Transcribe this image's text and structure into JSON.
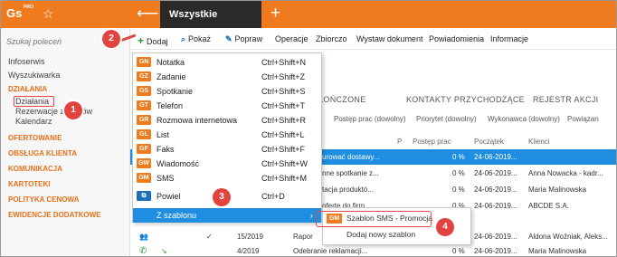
{
  "app": {
    "logo": "Gs",
    "logo_sup": "PRO",
    "window_tab": "Wszystkie działania",
    "back_icon": "arrow-left-icon",
    "new_tab_icon": "plus-icon",
    "accent": "#f07b1e",
    "selection": "#1f8de0",
    "annotation": "#e3433f"
  },
  "sidebar": {
    "search_placeholder": "Szukaj poleceń",
    "items": [
      {
        "label": "Infoserwis"
      },
      {
        "label": "Wyszukiwarka"
      },
      {
        "label": "DZIAŁANIA"
      },
      {
        "label": "Działania"
      },
      {
        "label": "Rezerwacje zasobów"
      },
      {
        "label": "Kalendarz"
      },
      {
        "label": "OFERTOWANIE"
      },
      {
        "label": "OBSŁUGA KLIENTA"
      },
      {
        "label": "KOMUNIKACJA"
      },
      {
        "label": "KARTOTEKI"
      },
      {
        "label": "POLITYKA CENOWA"
      },
      {
        "label": "EWIDENCJE DODATKOWE"
      }
    ]
  },
  "toolbar": {
    "dodaj": "Dodaj",
    "pokaz": "Pokaż",
    "popraw": "Popraw",
    "operacje": "Operacje",
    "zbiorczo": "Zbiorczo",
    "wystaw": "Wystaw dokument",
    "powiadomienia": "Powiadomienia",
    "informacje": "Informacje"
  },
  "tabs": [
    "ZAKOŃCZONE",
    "KONTAKTY PRZYCHODZĄCE",
    "REJESTR AKCJI"
  ],
  "filters": [
    "Postęp prac (dowolny)",
    "Priorytet (dowolny)",
    "Wykonawca (dowolny)",
    "Powiązan"
  ],
  "columns": {
    "p": "P",
    "postep": "Postęp prac",
    "poczatek": "Początek",
    "klienci": "Klienci"
  },
  "rows": [
    {
      "nr": "",
      "temat": "urować dostawy...",
      "postep": "0 %",
      "data": "24-06-2019...",
      "klient": ""
    },
    {
      "nr": "",
      "temat": "nne spotkanie z...",
      "postep": "0 %",
      "data": "24-06-2019...",
      "klient": "Anna Nowacka - kadr..."
    },
    {
      "nr": "",
      "temat": "tacja produktó...",
      "postep": "0 %",
      "data": "24-06-2019...",
      "klient": "Maria Malinowska"
    },
    {
      "nr": "",
      "temat": "oferte do firm...",
      "postep": "0 %",
      "data": "24-06-2019...",
      "klient": "ABCDE S.A."
    },
    {
      "nr": "",
      "temat": "",
      "postep": "",
      "data": "",
      "klient": ""
    },
    {
      "nr": "",
      "temat": "",
      "postep": "",
      "data": "",
      "klient": ""
    },
    {
      "nr": "15/2019",
      "temat": "Rapor",
      "postep": "0 %",
      "data": "24-06-2019...",
      "klient": "Aldona Woźniak, Aleks..."
    },
    {
      "nr": "4/2019",
      "temat": "Odebranie reklamacji...",
      "postep": "0 %",
      "data": "24-06-2019...",
      "klient": "Maria Malinowska"
    }
  ],
  "menu": [
    {
      "code": "GN",
      "color": "#f07b1e",
      "label": "Notatka",
      "shortcut": "Ctrl+Shift+N"
    },
    {
      "code": "GZ",
      "color": "#f07b1e",
      "label": "Zadanie",
      "shortcut": "Ctrl+Shift+Z"
    },
    {
      "code": "GS",
      "color": "#f07b1e",
      "label": "Spotkanie",
      "shortcut": "Ctrl+Shift+S"
    },
    {
      "code": "GT",
      "color": "#f07b1e",
      "label": "Telefon",
      "shortcut": "Ctrl+Shift+T"
    },
    {
      "code": "GR",
      "color": "#f07b1e",
      "label": "Rozmowa internetowa",
      "shortcut": "Ctrl+Shift+R"
    },
    {
      "code": "GL",
      "color": "#f07b1e",
      "label": "List",
      "shortcut": "Ctrl+Shift+L"
    },
    {
      "code": "GF",
      "color": "#f07b1e",
      "label": "Faks",
      "shortcut": "Ctrl+Shift+F"
    },
    {
      "code": "GW",
      "color": "#f07b1e",
      "label": "Wiadomość",
      "shortcut": "Ctrl+Shift+W"
    },
    {
      "code": "GM",
      "color": "#f07b1e",
      "label": "SMS",
      "shortcut": "Ctrl+Shift+M"
    },
    {
      "code": "",
      "color": "#1c6fb8",
      "label": "Powiel",
      "shortcut": "Ctrl+D"
    },
    {
      "code": "",
      "color": "",
      "label": "Z szablonu",
      "shortcut": ""
    }
  ],
  "submenu": {
    "code": "GM",
    "item1": "Szablon SMS - Promocja",
    "item2": "Dodaj nowy szablon"
  },
  "badges": [
    "1",
    "2",
    "3",
    "4"
  ]
}
